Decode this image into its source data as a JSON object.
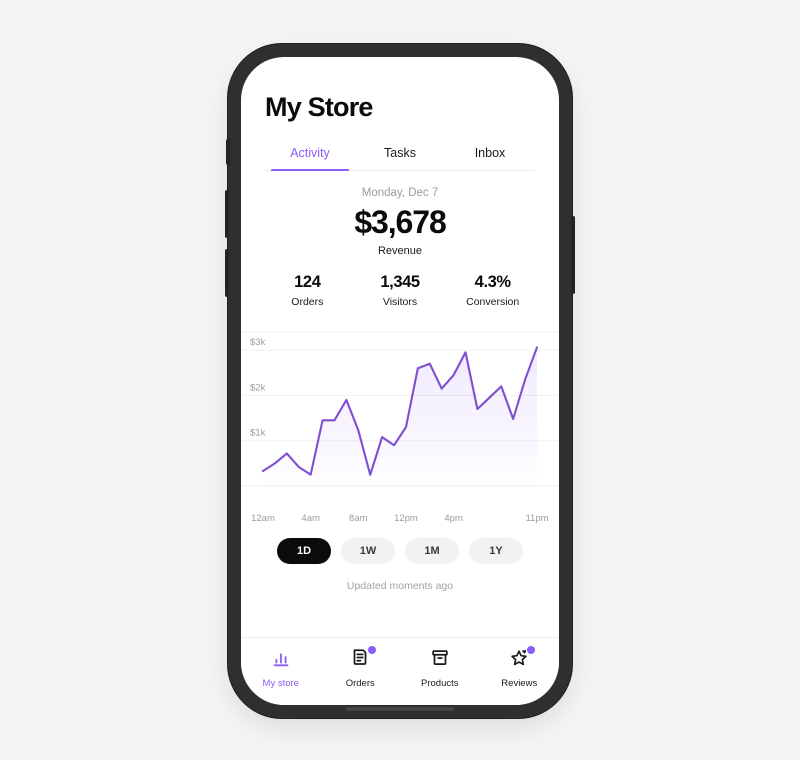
{
  "theme": {
    "accent": "#8b5cf6",
    "line_color": "#7e4fd0",
    "page_background": "#f4f5f6",
    "screen_background": "#ffffff",
    "frame_color": "#2e2f30",
    "text_primary": "#0b0b0c",
    "text_muted": "#9b9ba1",
    "chip_background": "#f2f2f4",
    "chip_active_background": "#0b0b0c"
  },
  "header": {
    "title": "My Store"
  },
  "tabs": [
    {
      "label": "Activity",
      "active": true
    },
    {
      "label": "Tasks",
      "active": false
    },
    {
      "label": "Inbox",
      "active": false
    }
  ],
  "summary": {
    "date": "Monday, Dec 7",
    "revenue_value": "$3,678",
    "revenue_label": "Revenue",
    "metrics": [
      {
        "value": "124",
        "label": "Orders"
      },
      {
        "value": "1,345",
        "label": "Visitors"
      },
      {
        "value": "4.3%",
        "label": "Conversion"
      }
    ]
  },
  "chart_data": {
    "type": "area",
    "title": "",
    "xlabel": "",
    "ylabel": "",
    "ylim": [
      0,
      3400
    ],
    "xlim": [
      0,
      23
    ],
    "grid": true,
    "legend": false,
    "y_ticks": [
      1000,
      2000,
      3000
    ],
    "y_tick_labels": [
      "$1k",
      "$2k",
      "$3k"
    ],
    "x_tick_positions": [
      0,
      4,
      8,
      12,
      16,
      23
    ],
    "x_tick_labels": [
      "12am",
      "4am",
      "8am",
      "12pm",
      "4pm",
      "11pm"
    ],
    "series": [
      {
        "name": "Revenue",
        "color": "#7e4fd0",
        "x": [
          0,
          1,
          2,
          3,
          4,
          5,
          6,
          7,
          8,
          9,
          10,
          11,
          12,
          13,
          14,
          15,
          16,
          17,
          18,
          19,
          20,
          21,
          22,
          23
        ],
        "values": [
          330,
          500,
          720,
          420,
          250,
          1450,
          1450,
          1900,
          1230,
          250,
          1080,
          900,
          1300,
          2600,
          2700,
          2150,
          2450,
          2950,
          1700,
          1950,
          2200,
          1480,
          2350,
          3060
        ]
      }
    ]
  },
  "range_selector": {
    "options": [
      {
        "label": "1D",
        "active": true
      },
      {
        "label": "1W",
        "active": false
      },
      {
        "label": "1M",
        "active": false
      },
      {
        "label": "1Y",
        "active": false
      }
    ]
  },
  "updated_text": "Updated moments ago",
  "bottom_nav": [
    {
      "label": "My store",
      "icon": "bar-chart-icon",
      "active": true,
      "badge": false
    },
    {
      "label": "Orders",
      "icon": "document-icon",
      "active": false,
      "badge": true
    },
    {
      "label": "Products",
      "icon": "archive-box-icon",
      "active": false,
      "badge": false
    },
    {
      "label": "Reviews",
      "icon": "star-sparkle-icon",
      "active": false,
      "badge": true
    }
  ]
}
